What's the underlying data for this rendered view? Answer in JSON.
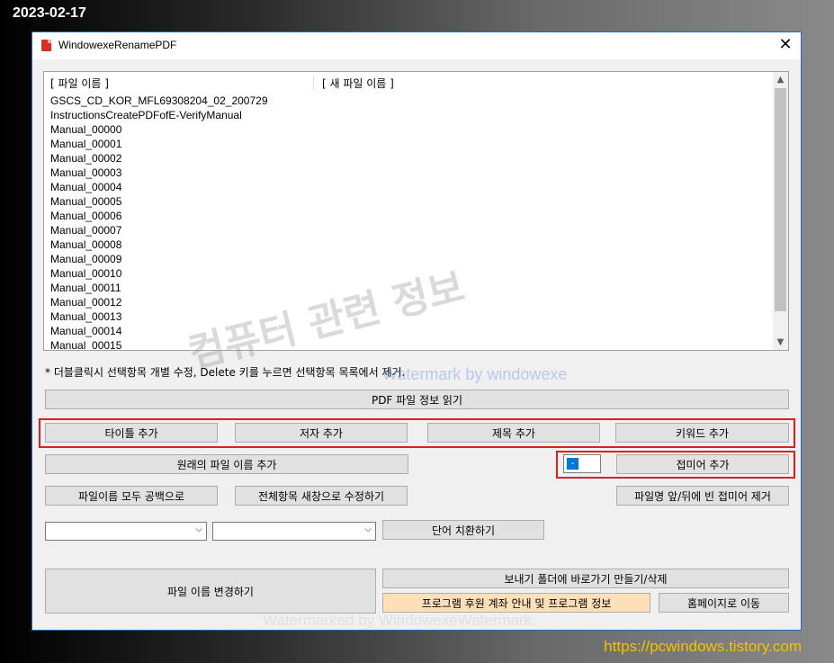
{
  "overlay": {
    "date": "2023-02-17",
    "site_url": "https://pcwindows.tistory.com",
    "watermark_main": "컴퓨터 관련 정보",
    "watermark_blue": "Watermark by windowexe",
    "watermark_bottom": "Watermarked by WindowexeWatermark"
  },
  "window": {
    "title": "WindowexeRenamePDF",
    "close_glyph": "✕"
  },
  "list": {
    "col_original": "[ 파일 이름 ]",
    "col_new": "[ 새 파일 이름 ]",
    "rows": [
      "GSCS_CD_KOR_MFL69308204_02_200729",
      "InstructionsCreatePDFofE-VerifyManual",
      "Manual_00000",
      "Manual_00001",
      "Manual_00002",
      "Manual_00003",
      "Manual_00004",
      "Manual_00005",
      "Manual_00006",
      "Manual_00007",
      "Manual_00008",
      "Manual_00009",
      "Manual_00010",
      "Manual_00011",
      "Manual_00012",
      "Manual_00013",
      "Manual_00014",
      "Manual_00015"
    ]
  },
  "hint": "* 더블클릭시 선택항목 개별 수정, Delete 키를 누르면 선택항목 목록에서 제거.",
  "buttons": {
    "read_pdf_info": "PDF 파일 정보 읽기",
    "add_title": "타이틀 추가",
    "add_author": "저자 추가",
    "add_subject": "제목 추가",
    "add_keyword": "키워드 추가",
    "add_original_name": "원래의 파일 이름 추가",
    "suffix_value": "-",
    "add_suffix": "접미어 추가",
    "all_spaces": "파일이름 모두 공백으로",
    "edit_all_new_window": "전체항목 새창으로 수정하기",
    "remove_blank_suffix": "파일명 앞/뒤에 빈 접미어 제거",
    "replace_word": "단어 치환하기",
    "rename_files": "파일 이름 변경하기",
    "send_to_shortcut": "보내기 폴더에 바로가기 만들기/삭제",
    "sponsor_info": "프로그램 후원 계좌 안내 및 프로그램 정보",
    "go_homepage": "홈페이지로 이동"
  },
  "combos": {
    "find_value": "",
    "replace_value": ""
  },
  "colors": {
    "highlight_box": "#e02020",
    "sponsor_button": "#fde0b8",
    "url_text": "#f2c200",
    "window_border": "#1c6fc9"
  }
}
